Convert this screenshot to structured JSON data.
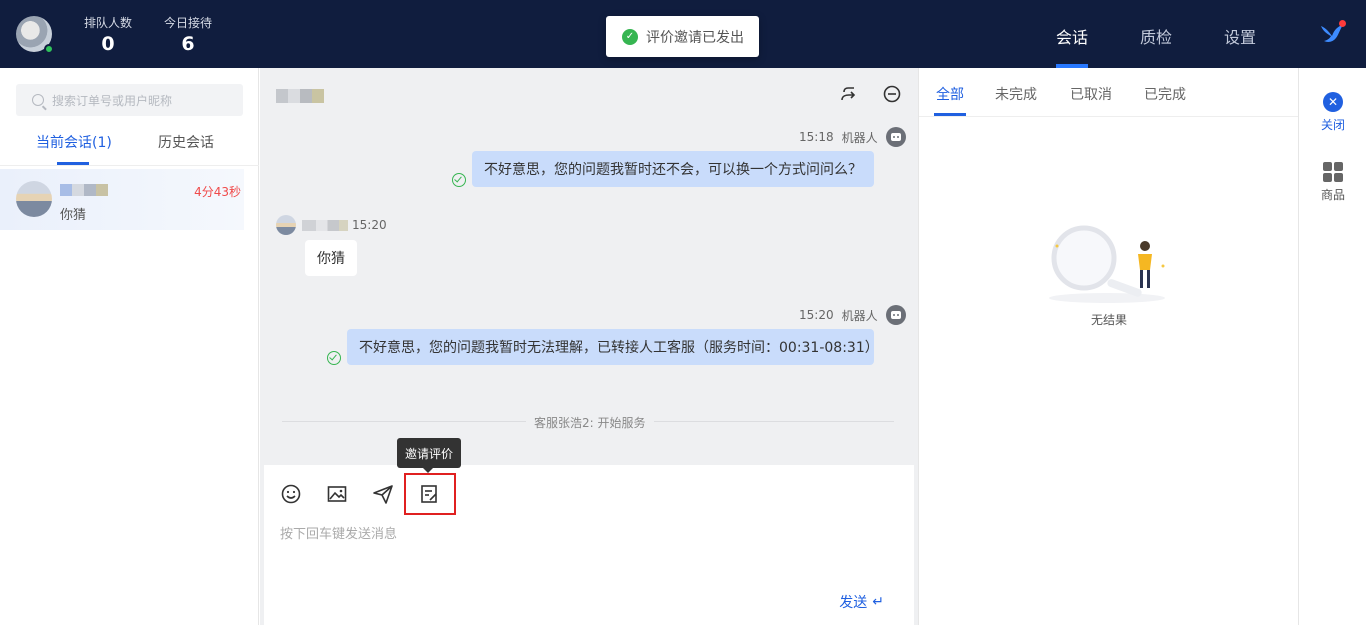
{
  "topbar": {
    "queue_label": "排队人数",
    "queue_count": "0",
    "today_label": "今日接待",
    "today_count": "6",
    "toast_text": "评价邀请已发出",
    "nav": [
      "会话",
      "质检",
      "设置"
    ]
  },
  "left": {
    "search_placeholder": "搜索订单号或用户昵称",
    "tabs": [
      "当前会话(1)",
      "历史会话"
    ],
    "conversation": {
      "message": "你猜",
      "timer": "4分43秒"
    }
  },
  "chat": {
    "messages": [
      {
        "time": "15:18",
        "sender": "机器人",
        "text": "不好意思，您的问题我暂时还不会，可以换一个方式问问么？"
      },
      {
        "time": "15:20",
        "text": "你猜"
      },
      {
        "time": "15:20",
        "sender": "机器人",
        "text": "不好意思，您的问题我暂时无法理解，已转接人工客服（服务时间：00:31-08:31）"
      }
    ],
    "system_notice": "客服张浩2: 开始服务",
    "tooltip": "邀请评价",
    "input_placeholder": "按下回车键发送消息",
    "send_label": "发送"
  },
  "right": {
    "tabs": [
      "全部",
      "未完成",
      "已取消",
      "已完成"
    ],
    "empty_text": "无结果"
  },
  "side": {
    "close_label": "关闭",
    "products_label": "商品"
  }
}
